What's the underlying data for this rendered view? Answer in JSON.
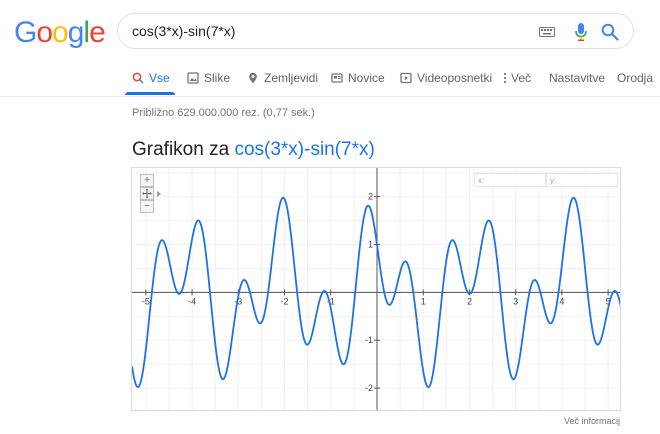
{
  "logo": {
    "letters": [
      "G",
      "o",
      "o",
      "g",
      "l",
      "e"
    ],
    "colors": [
      "#4285f4",
      "#ea4335",
      "#fbbc05",
      "#4285f4",
      "#34a853",
      "#ea4335"
    ]
  },
  "search": {
    "query": "cos(3*x)-sin(7*x)"
  },
  "tabs": [
    {
      "label": "Vse",
      "icon": "search-icon",
      "active": true
    },
    {
      "label": "Slike",
      "icon": "image-icon"
    },
    {
      "label": "Zemljevidi",
      "icon": "map-pin-icon"
    },
    {
      "label": "Novice",
      "icon": "news-icon"
    },
    {
      "label": "Videoposnetki",
      "icon": "play-icon"
    },
    {
      "label": "Več",
      "icon": "more-vert-icon"
    },
    {
      "label": "Nastavitve"
    },
    {
      "label": "Orodja"
    }
  ],
  "stats": "Približno 629.000.000 rez. (0,77 sek.)",
  "title": {
    "prefix": "Grafikon za",
    "function": "cos(3*x)-sin(7*x)"
  },
  "graph": {
    "coord_x_label": "x:",
    "coord_y_label": "y:",
    "zoom_in": "+",
    "zoom_out": "−",
    "more_info": "Več informacij"
  },
  "chart_data": {
    "type": "line",
    "function": "cos(3*x)-sin(7*x)",
    "xlim": [
      -5.3,
      5.3
    ],
    "ylim": [
      -2.5,
      2.6
    ],
    "x_ticks": [
      -5,
      -4,
      -3,
      -2,
      -1,
      1,
      2,
      3,
      4,
      5
    ],
    "y_ticks": [
      -2,
      -1,
      1,
      2
    ],
    "grid": true,
    "line_color": "#1a73e8"
  }
}
